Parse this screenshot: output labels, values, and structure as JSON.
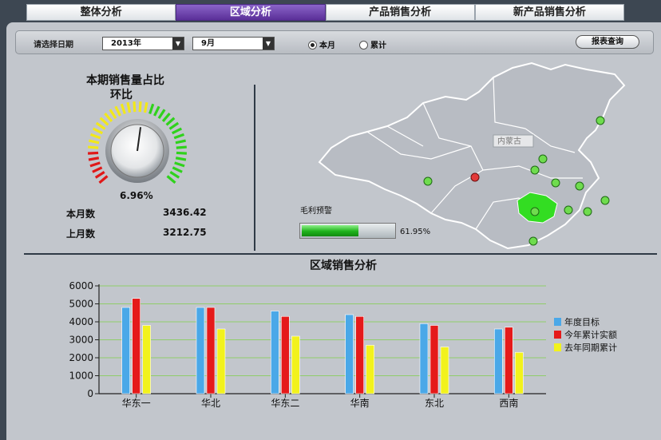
{
  "tabs": [
    "整体分析",
    "区域分析",
    "产品销售分析",
    "新产品销售分析"
  ],
  "active_tab": 1,
  "filter": {
    "label": "请选择日期",
    "year": "2013年",
    "month": "9月",
    "radio_month": "本月",
    "radio_cumulative": "累计",
    "query_button": "报表查询"
  },
  "gauge": {
    "title": "本期销售量占比",
    "subtitle": "环比",
    "percent_text": "6.96%",
    "needle_value": 0.53,
    "this_month_label": "本月数",
    "this_month_value": "3436.42",
    "last_month_label": "上月数",
    "last_month_value": "3212.75"
  },
  "map": {
    "tooltip": "内蒙古",
    "profit_label": "毛利预警",
    "profit_value": 0.6195,
    "profit_text": "61.95%",
    "highlight_color": "#33dd22"
  },
  "chart_data": {
    "type": "bar",
    "title": "区域销售分析",
    "categories": [
      "华东一",
      "华北",
      "华东二",
      "华南",
      "东北",
      "西南"
    ],
    "series": [
      {
        "name": "年度目标",
        "color": "#4aa8e8",
        "values": [
          4800,
          4800,
          4600,
          4400,
          3900,
          3600
        ]
      },
      {
        "name": "今年累计实额",
        "color": "#e51a1a",
        "values": [
          5300,
          4800,
          4300,
          4300,
          3800,
          3700
        ]
      },
      {
        "name": "去年同期累计",
        "color": "#f2f21c",
        "values": [
          3800,
          3600,
          3200,
          2700,
          2600,
          2300
        ]
      }
    ],
    "ylim": [
      0,
      6000
    ],
    "yticks": [
      "0",
      "1000",
      "2000",
      "3000",
      "4000",
      "5000",
      "6000"
    ],
    "grid": true,
    "legend": "right"
  }
}
